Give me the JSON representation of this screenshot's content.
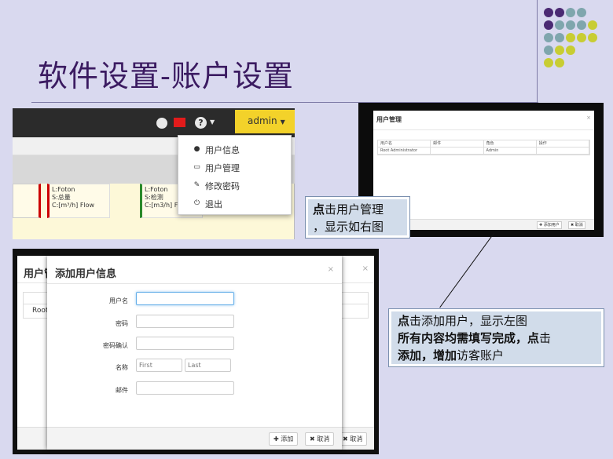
{
  "slide": {
    "title": "软件设置-账户设置",
    "dot_colors": [
      "#4b2a73",
      "#7fa6ad",
      "#c8cd33"
    ]
  },
  "topbar": {
    "admin_label": "admin",
    "accent": "#f3d22a"
  },
  "dashboard_cards": [
    {
      "line1": "L:Foton",
      "line2": "S:总量",
      "line3": "C:[m³/h] Flow"
    },
    {
      "line1": "L:Foton",
      "line2": "S:检测",
      "line3": "C:[m3/h] Fl"
    }
  ],
  "user_menu": {
    "items": [
      {
        "label": "用户信息",
        "icon": "user-icon"
      },
      {
        "label": "用户管理",
        "icon": "drive-icon"
      },
      {
        "label": "修改密码",
        "icon": "edit-icon"
      },
      {
        "label": "退出",
        "icon": "power-icon"
      }
    ]
  },
  "user_mgmt": {
    "title": "用户管理",
    "close": "×",
    "columns": [
      "用户名",
      "邮件",
      "角色",
      "操作"
    ],
    "rows": [
      {
        "name": "Root Administrator",
        "email": "",
        "role": "Admin",
        "action": ""
      }
    ],
    "add_button": "✚ 添加用户",
    "cancel_button": "✖ 取消"
  },
  "callout1": {
    "bold": "点",
    "line1": "击用户管理",
    "line2": "，显示如右图"
  },
  "callout2": {
    "b1": "点",
    "t1": "击添加用户，显示左图",
    "b2": "所有内容均需填写完成，点",
    "t2": "击",
    "b3": "添加，增加",
    "t3": "访客账户"
  },
  "bg_modal": {
    "title": "用户管",
    "row1": "Root A",
    "cancel": "✖ 取消"
  },
  "add_user": {
    "title": "添加用户信息",
    "close": "×",
    "fields": [
      {
        "label": "用户名",
        "placeholder": ""
      },
      {
        "label": "密码",
        "placeholder": ""
      },
      {
        "label": "密码确认",
        "placeholder": ""
      },
      {
        "label": "名称",
        "placeholder_first": "First",
        "placeholder_last": "Last"
      },
      {
        "label": "邮件",
        "placeholder": ""
      }
    ],
    "add_button": "✚ 添加",
    "cancel_button": "✖ 取消"
  }
}
